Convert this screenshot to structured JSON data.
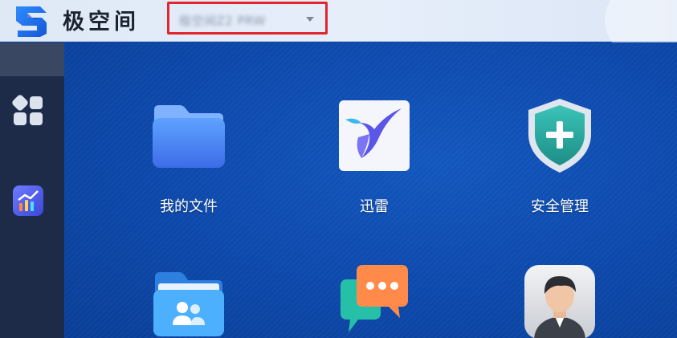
{
  "header": {
    "brand_name": "极空间",
    "device_name": "极空间Z2 PRW"
  },
  "sidebar": {
    "items": [
      {
        "icon": "apps-grid-icon"
      },
      {
        "icon": "system-monitor-icon"
      }
    ]
  },
  "desktop": {
    "apps": [
      {
        "label": "我的文件",
        "icon": "folder-icon"
      },
      {
        "label": "迅雷",
        "icon": "thunder-bird-icon"
      },
      {
        "label": "安全管理",
        "icon": "shield-plus-icon"
      },
      {
        "label": "",
        "icon": "shared-folder-icon"
      },
      {
        "label": "",
        "icon": "chat-bubbles-icon"
      },
      {
        "label": "",
        "icon": "user-avatar-icon"
      }
    ]
  },
  "colors": {
    "desktop_bg": "#0d49ac",
    "sidebar_bg": "#1d2a48",
    "highlight_border": "#e3262c",
    "folder_blue": "#3f7cf0",
    "shield_teal": "#2aa39a"
  }
}
